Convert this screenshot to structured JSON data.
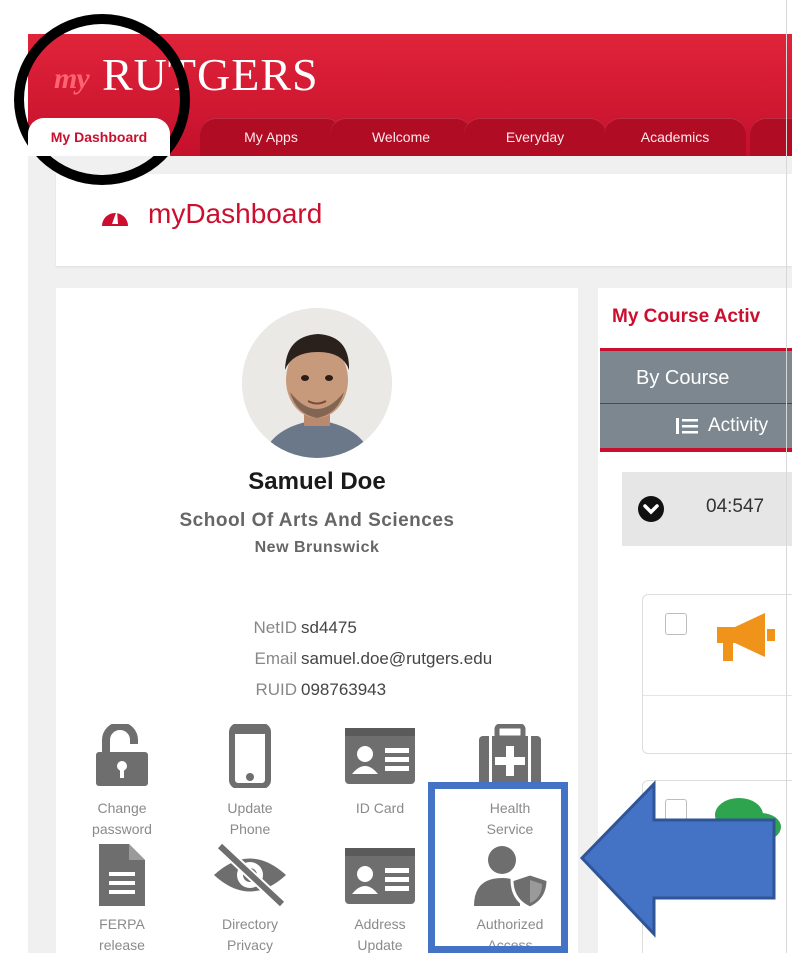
{
  "header": {
    "logo_my": "my",
    "logo_word": "RUTGERS",
    "tabs": [
      {
        "label": "My Dashboard"
      },
      {
        "label": "My Apps"
      },
      {
        "label": "Welcome"
      },
      {
        "label": "Everyday"
      },
      {
        "label": "Academics"
      },
      {
        "label": ""
      }
    ],
    "active_tab": "My Dashboard"
  },
  "page": {
    "title": "myDashboard"
  },
  "profile": {
    "name": "Samuel Doe",
    "school": "School Of Arts And Sciences",
    "campus": "New Brunswick",
    "fields": [
      {
        "label": "NetID",
        "value": "sd4475"
      },
      {
        "label": "Email",
        "value": "samuel.doe@rutgers.edu"
      },
      {
        "label": "RUID",
        "value": "098763943"
      }
    ]
  },
  "quick_links": [
    {
      "line1": "Change",
      "line2": "password",
      "icon": "unlock-icon"
    },
    {
      "line1": "Update",
      "line2": "Phone",
      "icon": "phone-icon"
    },
    {
      "line1": "ID Card",
      "line2": "",
      "icon": "id-card-icon"
    },
    {
      "line1": "Health",
      "line2": "Service",
      "icon": "health-kit-icon"
    },
    {
      "line1": "FERPA",
      "line2": "release",
      "icon": "document-icon"
    },
    {
      "line1": "Directory",
      "line2": "Privacy",
      "icon": "eye-slash-icon"
    },
    {
      "line1": "Address",
      "line2": "Update",
      "icon": "address-card-icon"
    },
    {
      "line1": "Authorized",
      "line2": "Access",
      "icon": "user-shield-icon"
    }
  ],
  "course_activity": {
    "title": "My Course Activ",
    "tab_label": "By Course",
    "activity_label": "Activity",
    "time_text": "04:547",
    "items": [
      {
        "icon": "megaphone-icon"
      },
      {
        "icon": "chat-bubbles-icon"
      }
    ]
  },
  "colors": {
    "brand_red": "#cc0f2e",
    "annotation_blue": "#4472c4",
    "icon_gray": "#6e6e6e",
    "megaphone_orange": "#f0931b",
    "chat_green": "#2ea44f"
  }
}
